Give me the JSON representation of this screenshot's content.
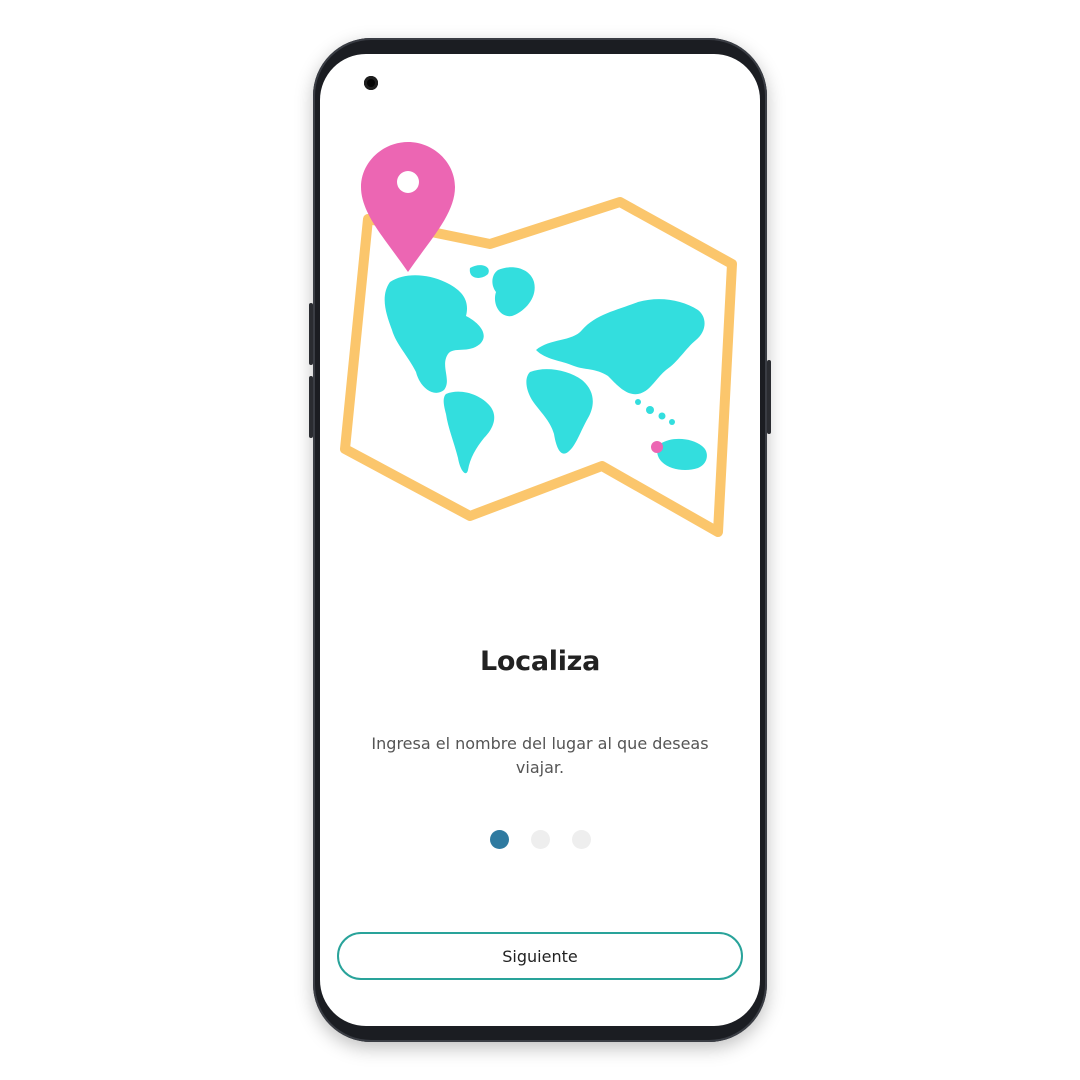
{
  "onboarding": {
    "title": "Localiza",
    "description": "Ingresa el nombre del lugar al que deseas viajar.",
    "pager": {
      "total": 3,
      "current": 1
    },
    "next_label": "Siguiente"
  },
  "colors": {
    "map_frame": "#fbc66c",
    "continents": "#33dede",
    "pin": "#ec66b3",
    "dot_active": "#2f7aa0",
    "dot_inactive": "#eeeeee",
    "button_border": "#29a39a"
  },
  "icons": {
    "illustration": "world-map-icon",
    "pin": "location-pin-icon"
  }
}
